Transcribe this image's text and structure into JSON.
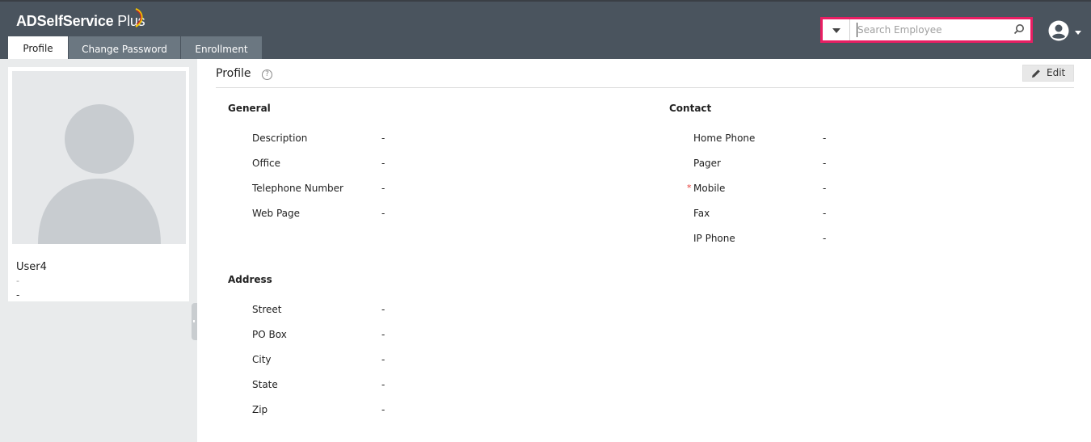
{
  "app": {
    "logo_bold": "ADSelfService",
    "logo_light": " Plus"
  },
  "tabs": [
    {
      "label": "Profile",
      "active": true
    },
    {
      "label": "Change Password",
      "active": false
    },
    {
      "label": "Enrollment",
      "active": false
    }
  ],
  "search": {
    "placeholder": "Search Employee",
    "value": ""
  },
  "colors": {
    "topbar": "#4a545e",
    "tab_inactive": "#6b7781",
    "search_highlight": "#e91e63",
    "required_star": "#e53935"
  },
  "user_card": {
    "name": "User4",
    "line1": "-",
    "line2": "-"
  },
  "page": {
    "title": "Profile",
    "help_icon": "?",
    "edit_label": "Edit"
  },
  "general": {
    "title": "General",
    "fields": [
      {
        "label": "Description",
        "value": "-"
      },
      {
        "label": "Office",
        "value": "-"
      },
      {
        "label": "Telephone Number",
        "value": "-"
      },
      {
        "label": "Web Page",
        "value": "-"
      }
    ]
  },
  "contact": {
    "title": "Contact",
    "fields": [
      {
        "label": "Home Phone",
        "value": "-",
        "required": false
      },
      {
        "label": "Pager",
        "value": "-",
        "required": false
      },
      {
        "label": "Mobile",
        "value": "-",
        "required": true
      },
      {
        "label": "Fax",
        "value": "-",
        "required": false
      },
      {
        "label": "IP Phone",
        "value": "-",
        "required": false
      }
    ]
  },
  "address": {
    "title": "Address",
    "fields": [
      {
        "label": "Street",
        "value": "-"
      },
      {
        "label": "PO Box",
        "value": "-"
      },
      {
        "label": "City",
        "value": "-"
      },
      {
        "label": "State",
        "value": "-"
      },
      {
        "label": "Zip",
        "value": "-"
      }
    ]
  }
}
